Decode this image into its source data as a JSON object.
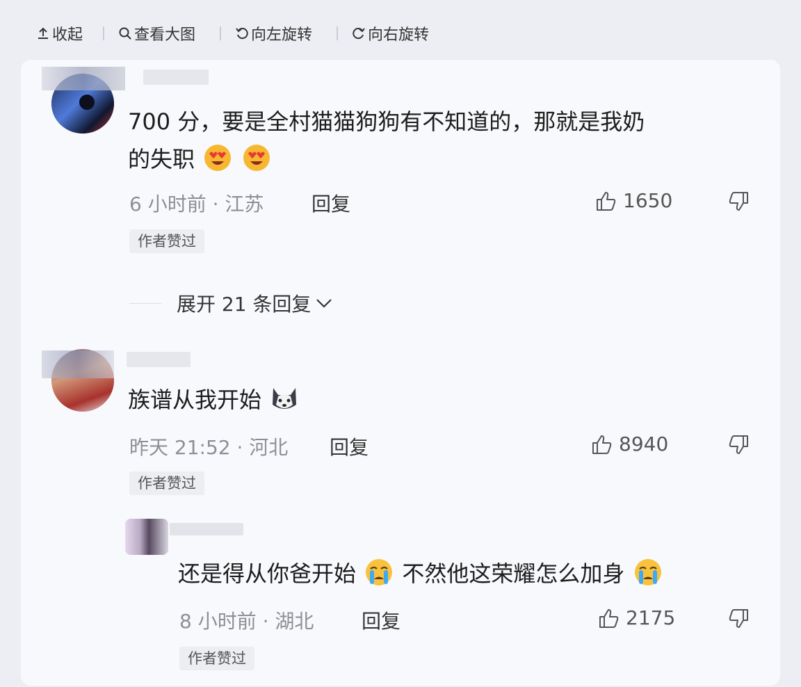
{
  "toolbar": {
    "collapse": "收起",
    "view_large": "查看大图",
    "rotate_left": "向左旋转",
    "rotate_right": "向右旋转"
  },
  "comments": [
    {
      "text_line1": "700 分，要是全村猫猫狗狗有不知道的，那就是我奶",
      "text_line2": "的失职",
      "meta": "6 小时前 · 江苏",
      "reply": "回复",
      "likes": "1650",
      "badge": "作者赞过"
    },
    {
      "text": "族谱从我开始",
      "meta": "昨天 21:52 · 河北",
      "reply": "回复",
      "likes": "8940",
      "badge": "作者赞过"
    }
  ],
  "expand_replies": "展开 21 条回复",
  "sub_reply": {
    "text_part1": "还是得从你爸开始",
    "text_part2": "不然他这荣耀怎么加身",
    "meta": "8 小时前 · 湖北",
    "reply": "回复",
    "likes": "2175",
    "badge": "作者赞过"
  },
  "icons": {
    "collapse": "upload-arrow-icon",
    "view_large": "magnifier-icon",
    "rotate_left": "rotate-left-icon",
    "rotate_right": "rotate-right-icon",
    "like": "thumbs-up-icon",
    "dislike": "thumbs-down-icon",
    "emoji_heart_eyes": "heart-eyes-emoji",
    "emoji_husky": "husky-emoji",
    "emoji_crying": "crying-emoji"
  },
  "colors": {
    "background": "#eceef3",
    "card": "#f8f9fc",
    "meta_text": "#8d8f96",
    "badge_bg": "#eceef2"
  }
}
